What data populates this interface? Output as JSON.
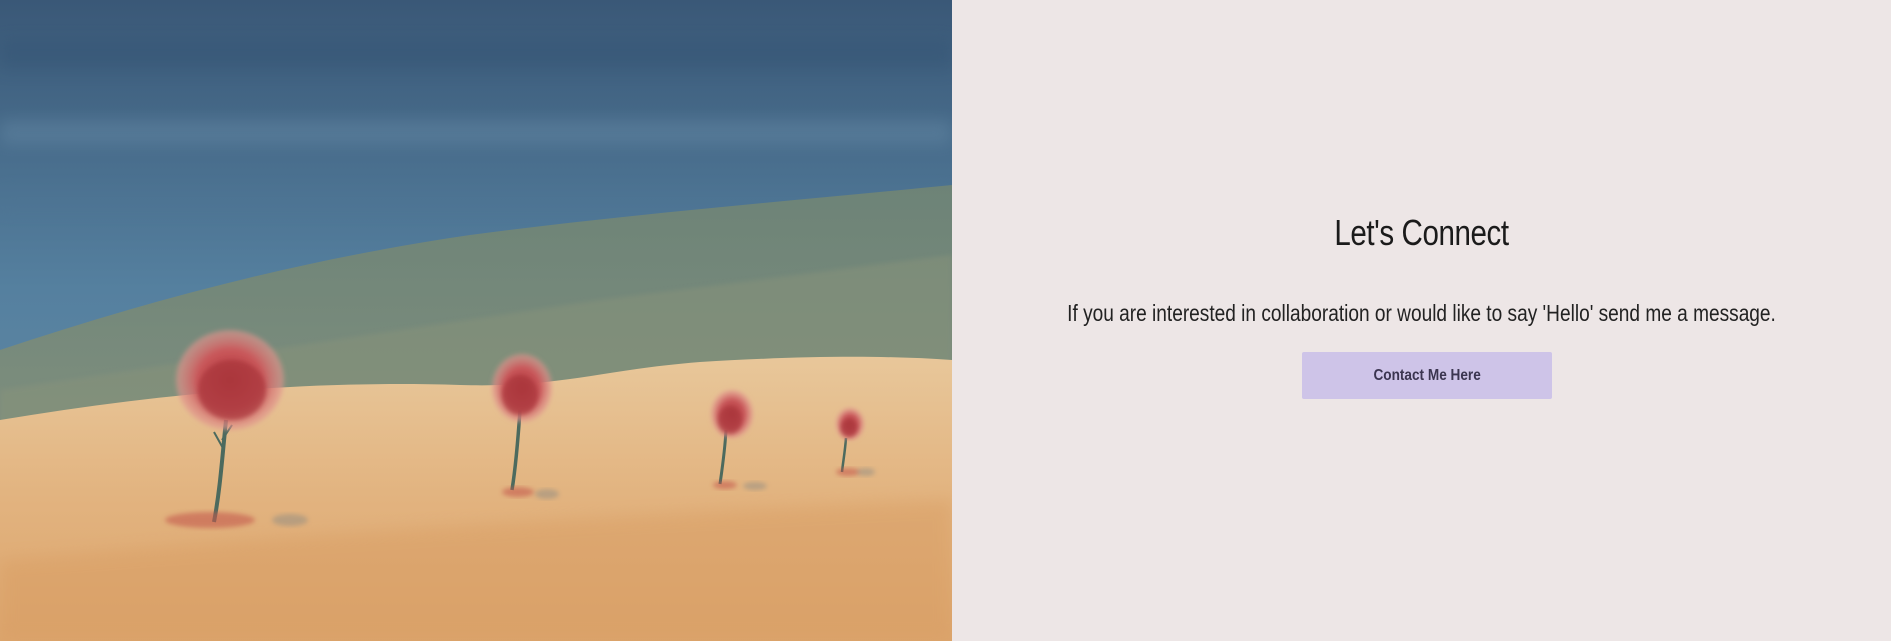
{
  "hero_image": {
    "alt": "Watercolor painting of four red trees on a sandy hill under a blue sky",
    "icon": "watercolor-landscape"
  },
  "contact": {
    "heading": "Let's Connect",
    "message": "If you are interested in collaboration or would like to say 'Hello' send me a message.",
    "button_label": "Contact Me Here"
  },
  "colors": {
    "panel_background": "#ede6e6",
    "button_background": "#cec4e8",
    "button_text": "#3b3550",
    "heading_text": "#1b1b1b"
  }
}
